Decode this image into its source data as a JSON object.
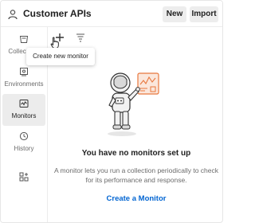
{
  "header": {
    "workspace_icon": "workspace-person-icon",
    "title": "Customer APIs",
    "new_label": "New",
    "import_label": "Import"
  },
  "sidebar": {
    "items": [
      {
        "label": "Collections",
        "icon": "collections-icon",
        "active": false
      },
      {
        "label": "Environments",
        "icon": "environments-icon",
        "active": false
      },
      {
        "label": "Monitors",
        "icon": "monitors-icon",
        "active": true
      },
      {
        "label": "History",
        "icon": "history-icon",
        "active": false
      },
      {
        "label": "",
        "icon": "configure-workbench-icon",
        "active": false
      }
    ]
  },
  "toolbar": {
    "add_icon": "plus-icon",
    "filter_icon": "filter-icon",
    "tooltip": "Create new monitor"
  },
  "empty_state": {
    "illustration": "astronaut-with-monitor-dashboard",
    "title": "You have no monitors set up",
    "description": "A monitor lets you run a collection periodically to check for its performance and response.",
    "action_label": "Create a Monitor"
  },
  "colors": {
    "accent_link": "#0265d2",
    "active_bg": "#ececec",
    "button_bg": "#ededed",
    "illustration_orange": "#e8773d"
  }
}
